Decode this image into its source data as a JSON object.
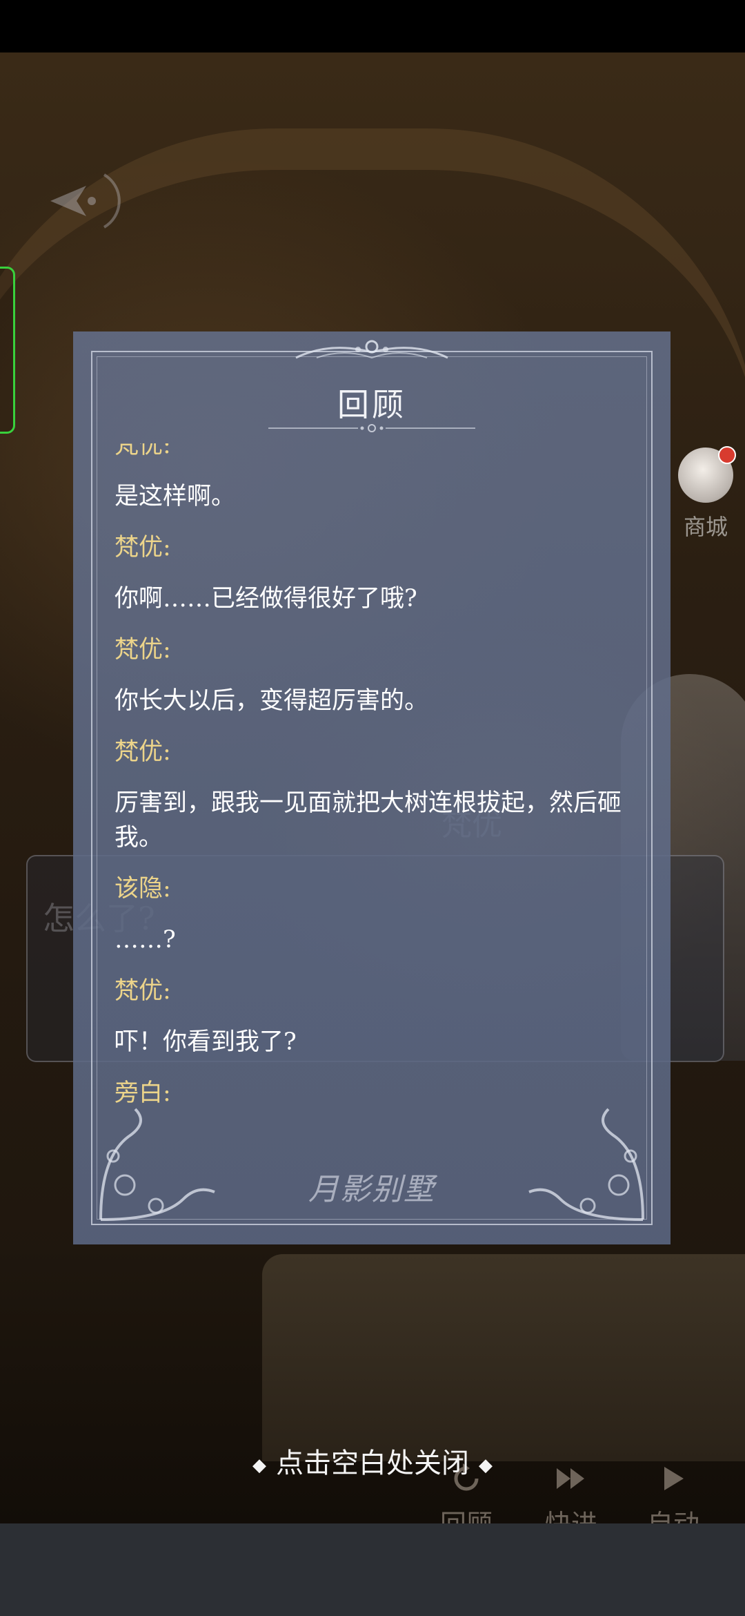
{
  "review": {
    "title": "回顾",
    "entries": [
      {
        "type": "speaker",
        "text": "梵优:"
      },
      {
        "type": "text",
        "text": "是这样啊。"
      },
      {
        "type": "speaker",
        "text": "梵优:"
      },
      {
        "type": "text",
        "text": "你啊……已经做得很好了哦?"
      },
      {
        "type": "speaker",
        "text": "梵优:"
      },
      {
        "type": "text",
        "text": "你长大以后，变得超厉害的。"
      },
      {
        "type": "speaker",
        "text": "梵优:"
      },
      {
        "type": "text",
        "text": "厉害到，跟我一见面就把大树连根拔起，然后砸我。"
      },
      {
        "type": "speaker",
        "text": "该隐:"
      },
      {
        "type": "text",
        "text": "……?"
      },
      {
        "type": "speaker",
        "text": "梵优:"
      },
      {
        "type": "text",
        "text": "吓！你看到我了?"
      },
      {
        "type": "speaker",
        "text": "旁白:"
      }
    ],
    "logo_text": "月影别墅"
  },
  "close_hint": "点击空白处关闭",
  "shop_label": "商城",
  "background": {
    "speaker_name": "梵优",
    "dialog_text": "怎么了?"
  },
  "controls": {
    "review": "回顾",
    "fast_forward": "快进",
    "auto": "自动"
  },
  "colors": {
    "speaker": "#ecd48a",
    "text": "#ffffff",
    "panel": "#64708c",
    "side_tab": "#39d13c"
  }
}
